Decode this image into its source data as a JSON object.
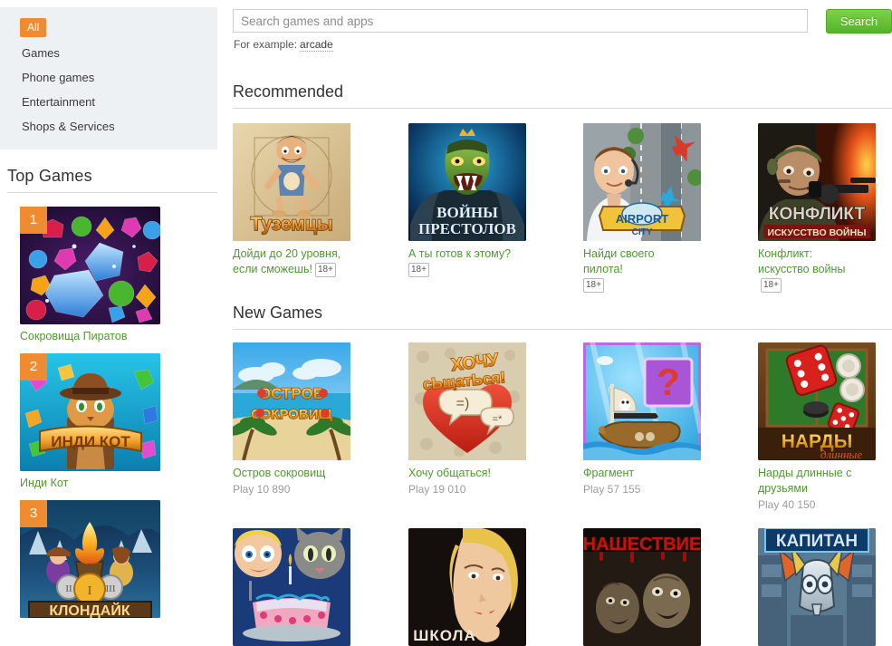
{
  "sidebar": {
    "nav": [
      {
        "label": "All",
        "selected": true
      },
      {
        "label": "Games",
        "selected": false
      },
      {
        "label": "Phone games",
        "selected": false
      },
      {
        "label": "Entertainment",
        "selected": false
      },
      {
        "label": "Shops & Services",
        "selected": false
      }
    ],
    "top_games_title": "Top Games",
    "top_games": [
      {
        "rank": "1",
        "title": "Сокровища Пиратов",
        "art": "gems"
      },
      {
        "rank": "2",
        "title": "Инди Кот",
        "art": "cat"
      },
      {
        "rank": "3",
        "title": "",
        "art": "klondike"
      }
    ]
  },
  "search": {
    "placeholder": "Search games and apps",
    "value": "",
    "button_label": "Search",
    "example_label": "For example:",
    "example_link": "arcade"
  },
  "sections": {
    "recommended_title": "Recommended",
    "new_games_title": "New Games"
  },
  "recommended": [
    {
      "title": "Дойди до 20 уровня, если сможешь!",
      "age": "18+",
      "art": "tuzemcy"
    },
    {
      "title": "А ты готов к этому?",
      "age": "18+",
      "art": "thrones"
    },
    {
      "title": "Найди своего пилота!",
      "age": "18+",
      "art": "airport"
    },
    {
      "title": "Конфликт: искусство войны",
      "age": "18+",
      "art": "conflict"
    }
  ],
  "new_games": [
    {
      "title": "Остров сокровищ",
      "plays": "Play 10 890",
      "art": "island"
    },
    {
      "title": "Хочу общаться!",
      "plays": "Play 19 010",
      "art": "chat"
    },
    {
      "title": "Фрагмент",
      "plays": "Play 57 155",
      "art": "fragment"
    },
    {
      "title": "Нарды длинные с друзьями",
      "plays": "Play 40 150",
      "art": "nardy"
    }
  ],
  "more_row": [
    {
      "art": "cake"
    },
    {
      "art": "school"
    },
    {
      "art": "invasion"
    },
    {
      "art": "kapitan"
    }
  ],
  "colors": {
    "accent_orange": "#ef8c32",
    "link_green": "#4f9a2f",
    "button_green": "#54b32a",
    "sidebar_bg": "#eef1f4"
  }
}
